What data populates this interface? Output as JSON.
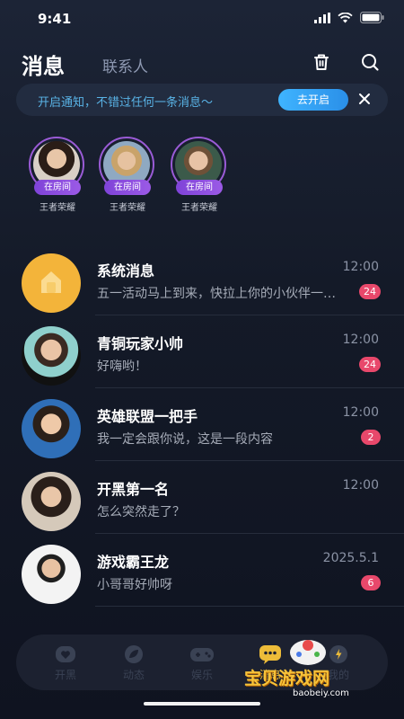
{
  "status_bar": {
    "time": "9:41"
  },
  "header": {
    "active_tab": "消息",
    "tab": "联系人"
  },
  "banner": {
    "text": "开启通知，不错过任何一条消息～",
    "button": "去开启"
  },
  "stories": [
    {
      "tag": "在房间",
      "name": "王者荣耀"
    },
    {
      "tag": "在房间",
      "name": "王者荣耀"
    },
    {
      "tag": "在房间",
      "name": "王者荣耀"
    }
  ],
  "messages": [
    {
      "title": "系统消息",
      "time": "12:00",
      "preview": "五一活动马上到来，快拉上你的小伙伴一起参加吧",
      "badge": "24"
    },
    {
      "title": "青铜玩家小帅",
      "time": "12:00",
      "preview": "好嗨哟！",
      "badge": "24"
    },
    {
      "title": "英雄联盟一把手",
      "time": "12:00",
      "preview": "我一定会跟你说，这是一段内容",
      "badge": "2"
    },
    {
      "title": "开黑第一名",
      "time": "12:00",
      "preview": "怎么突然走了？",
      "badge": ""
    },
    {
      "title": "游戏霸王龙",
      "time": "2025.5.1",
      "preview": "小哥哥好帅呀",
      "badge": "6"
    }
  ],
  "tabbar": [
    {
      "label": "开黑",
      "icon": "heart-game-icon"
    },
    {
      "label": "动态",
      "icon": "leaf-icon"
    },
    {
      "label": "娱乐",
      "icon": "gamepad-icon"
    },
    {
      "label": "消息",
      "icon": "chat-icon"
    },
    {
      "label": "我的",
      "icon": "user-icon"
    }
  ],
  "watermark": {
    "text": "宝贝游戏网",
    "url": "baobeiy.com"
  },
  "colors": {
    "accent": "#3fb4ff",
    "badge": "#e8486b",
    "story_ring": "#9a5bd6"
  }
}
